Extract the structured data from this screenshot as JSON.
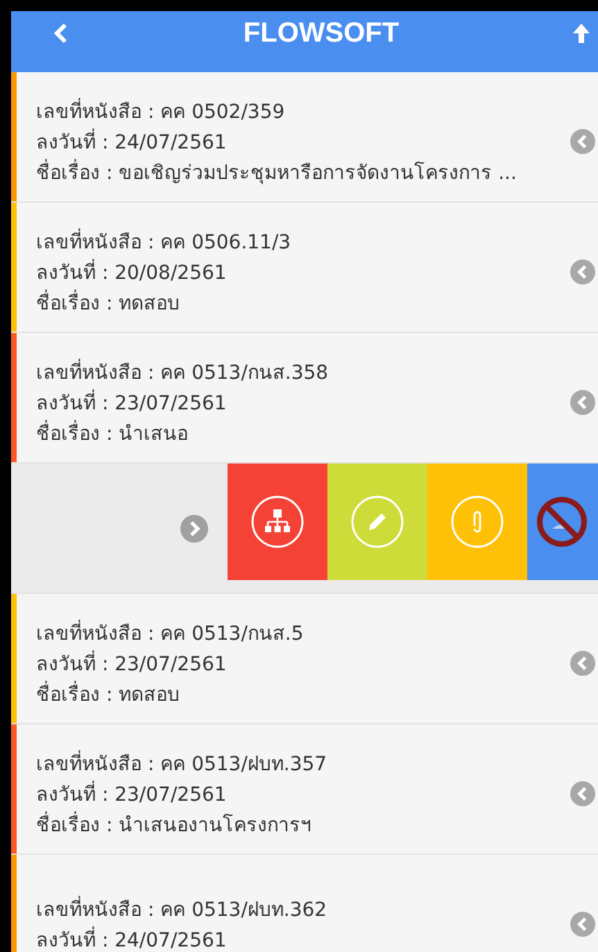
{
  "header": {
    "title": "FLOWSOFT"
  },
  "items": [
    {
      "number": "เลขที่หนังสือ : คค 0502/359",
      "date": "ลงวันที่ : 24/07/2561",
      "subject": "ชื่อเรื่อง : ขอเชิญร่วมประชุมหารือการจัดงานโครงการ ...",
      "color": "#ff9800"
    },
    {
      "number": "เลขที่หนังสือ : คค 0506.11/3",
      "date": "ลงวันที่ : 20/08/2561",
      "subject": "ชื่อเรื่อง : ทดสอบ",
      "color": "#ffc107"
    },
    {
      "number": "เลขที่หนังสือ : คค 0513/กนส.358",
      "date": "ลงวันที่ : 23/07/2561",
      "subject": "ชื่อเรื่อง : นำเสนอ",
      "color": "#ff5722"
    },
    {
      "kind": "actions",
      "actions": [
        {
          "kind": "flow",
          "color": "#f44336"
        },
        {
          "kind": "edit",
          "color": "#cddc39"
        },
        {
          "kind": "attach",
          "color": "#ffc107"
        },
        {
          "kind": "blocked",
          "color": "#4a8ef0"
        }
      ]
    },
    {
      "number": "เลขที่หนังสือ : คค 0513/กนส.5",
      "date": "ลงวันที่ : 23/07/2561",
      "subject": "ชื่อเรื่อง : ทดสอบ",
      "color": "#ffc107"
    },
    {
      "number": "เลขที่หนังสือ : คค 0513/ฝบท.357",
      "date": "ลงวันที่ : 23/07/2561",
      "subject": "ชื่อเรื่อง : นำเสนองานโครงการฯ",
      "color": "#ff5722"
    },
    {
      "number": "เลขที่หนังสือ : คค 0513/ฝบท.362",
      "date": "ลงวันที่ : 24/07/2561",
      "color": "#ff9800"
    }
  ]
}
